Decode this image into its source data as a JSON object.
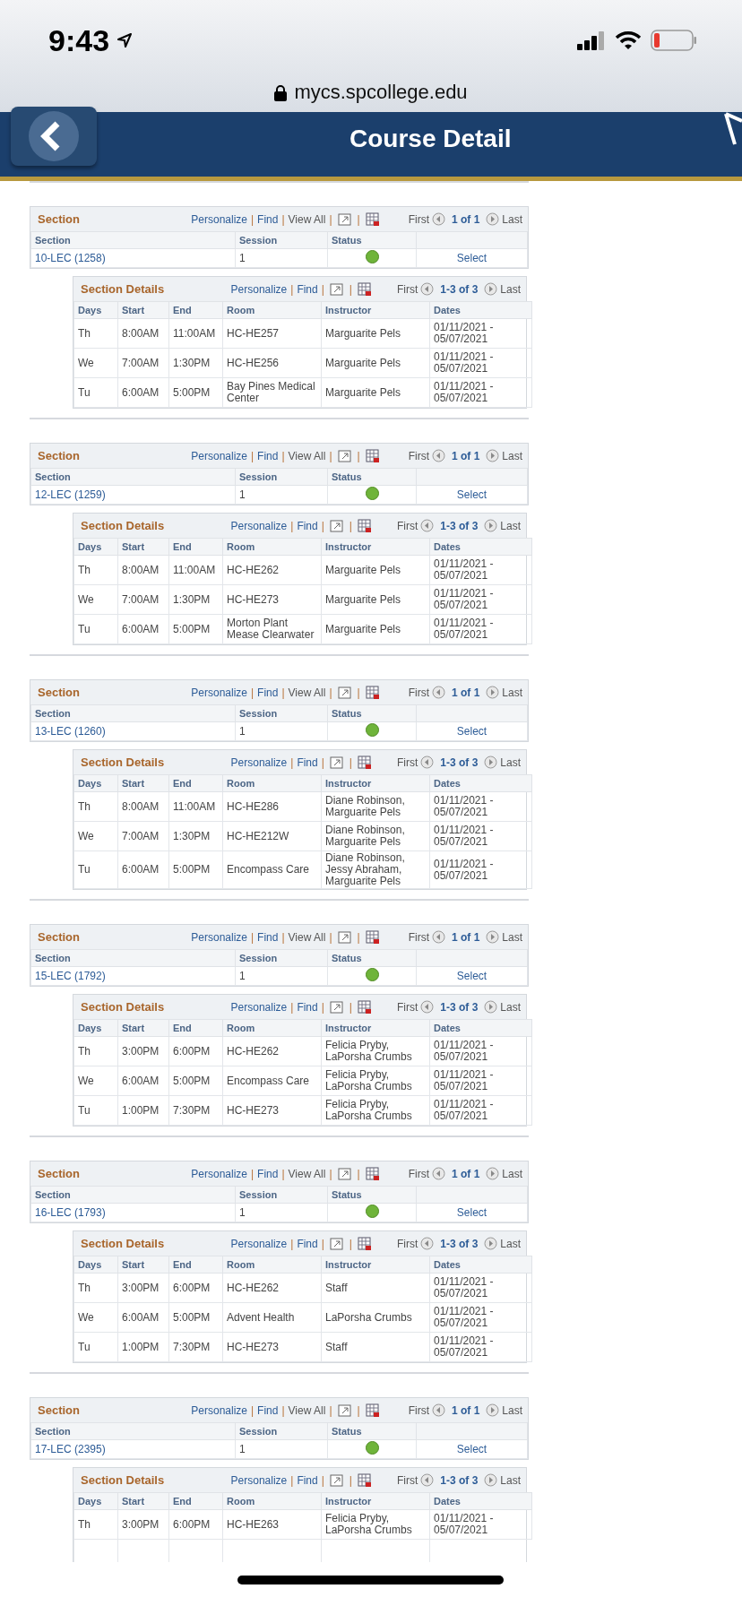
{
  "status_bar": {
    "time": "9:43"
  },
  "url_bar": {
    "url": "mycs.spcollege.edu"
  },
  "header": {
    "title": "Course Detail"
  },
  "sections": [
    {
      "title": "Section",
      "nav": {
        "personalize": "Personalize",
        "find": "Find",
        "view_all": "View All",
        "separators": [
          "|",
          "|",
          "|",
          "|"
        ],
        "first": "First",
        "count": "1 of 1",
        "last": "Last"
      },
      "columns": [
        "Section",
        "Session",
        "Status"
      ],
      "row": {
        "section": "10-LEC (1258)",
        "session": "1",
        "color": "#6fb43a",
        "action": "Select"
      },
      "details": {
        "title": "Section Details",
        "nav": {
          "personalize": "Personalize",
          "find": "Find",
          "separators": [
            "|",
            "|",
            "|"
          ],
          "first": "First",
          "count": "1-3 of 3",
          "last": "Last"
        },
        "columns": [
          "Days",
          "Start",
          "End",
          "Room",
          "Instructor",
          "Dates"
        ],
        "rows": [
          [
            "Th",
            "8:00AM",
            "11:00AM",
            "HC-HE257",
            "Marguarite Pels",
            "01/11/2021 - 05/07/2021"
          ],
          [
            "We",
            "7:00AM",
            "1:30PM",
            "HC-HE256",
            "Marguarite Pels",
            "01/11/2021 - 05/07/2021"
          ],
          [
            "Tu",
            "6:00AM",
            "5:00PM",
            "Bay Pines Medical Center",
            "Marguarite Pels",
            "01/11/2021 - 05/07/2021"
          ]
        ]
      }
    },
    {
      "title": "Section",
      "nav": {
        "personalize": "Personalize",
        "find": "Find",
        "view_all": "View All",
        "separators": [
          "|",
          "|",
          "|",
          "|"
        ],
        "first": "First",
        "count": "1 of 1",
        "last": "Last"
      },
      "columns": [
        "Section",
        "Session",
        "Status"
      ],
      "row": {
        "section": "12-LEC (1259)",
        "session": "1",
        "color": "#6fb43a",
        "action": "Select"
      },
      "details": {
        "title": "Section Details",
        "nav": {
          "personalize": "Personalize",
          "find": "Find",
          "separators": [
            "|",
            "|",
            "|"
          ],
          "first": "First",
          "count": "1-3 of 3",
          "last": "Last"
        },
        "columns": [
          "Days",
          "Start",
          "End",
          "Room",
          "Instructor",
          "Dates"
        ],
        "rows": [
          [
            "Th",
            "8:00AM",
            "11:00AM",
            "HC-HE262",
            "Marguarite Pels",
            "01/11/2021 - 05/07/2021"
          ],
          [
            "We",
            "7:00AM",
            "1:30PM",
            "HC-HE273",
            "Marguarite Pels",
            "01/11/2021 - 05/07/2021"
          ],
          [
            "Tu",
            "6:00AM",
            "5:00PM",
            "Morton Plant Mease Clearwater",
            "Marguarite Pels",
            "01/11/2021 - 05/07/2021"
          ]
        ]
      }
    },
    {
      "title": "Section",
      "nav": {
        "personalize": "Personalize",
        "find": "Find",
        "view_all": "View All",
        "separators": [
          "|",
          "|",
          "|",
          "|"
        ],
        "first": "First",
        "count": "1 of 1",
        "last": "Last"
      },
      "columns": [
        "Section",
        "Session",
        "Status"
      ],
      "row": {
        "section": "13-LEC (1260)",
        "session": "1",
        "color": "#6fb43a",
        "action": "Select"
      },
      "details": {
        "title": "Section Details",
        "nav": {
          "personalize": "Personalize",
          "find": "Find",
          "separators": [
            "|",
            "|",
            "|"
          ],
          "first": "First",
          "count": "1-3 of 3",
          "last": "Last"
        },
        "columns": [
          "Days",
          "Start",
          "End",
          "Room",
          "Instructor",
          "Dates"
        ],
        "rows": [
          [
            "Th",
            "8:00AM",
            "11:00AM",
            "HC-HE286",
            "Diane Robinson, Marguarite Pels",
            "01/11/2021 - 05/07/2021"
          ],
          [
            "We",
            "7:00AM",
            "1:30PM",
            "HC-HE212W",
            "Diane Robinson, Marguarite Pels",
            "01/11/2021 - 05/07/2021"
          ],
          [
            "Tu",
            "6:00AM",
            "5:00PM",
            "Encompass Care",
            "Diane Robinson, Jessy Abraham, Marguarite Pels",
            "01/11/2021 - 05/07/2021"
          ]
        ]
      }
    },
    {
      "title": "Section",
      "nav": {
        "personalize": "Personalize",
        "find": "Find",
        "view_all": "View All",
        "separators": [
          "|",
          "|",
          "|",
          "|"
        ],
        "first": "First",
        "count": "1 of 1",
        "last": "Last"
      },
      "columns": [
        "Section",
        "Session",
        "Status"
      ],
      "row": {
        "section": "15-LEC (1792)",
        "session": "1",
        "color": "#6fb43a",
        "action": "Select"
      },
      "details": {
        "title": "Section Details",
        "nav": {
          "personalize": "Personalize",
          "find": "Find",
          "separators": [
            "|",
            "|",
            "|"
          ],
          "first": "First",
          "count": "1-3 of 3",
          "last": "Last"
        },
        "columns": [
          "Days",
          "Start",
          "End",
          "Room",
          "Instructor",
          "Dates"
        ],
        "rows": [
          [
            "Th",
            "3:00PM",
            "6:00PM",
            "HC-HE262",
            "Felicia Pryby, LaPorsha Crumbs",
            "01/11/2021 - 05/07/2021"
          ],
          [
            "We",
            "6:00AM",
            "5:00PM",
            "Encompass Care",
            "Felicia Pryby, LaPorsha Crumbs",
            "01/11/2021 - 05/07/2021"
          ],
          [
            "Tu",
            "1:00PM",
            "7:30PM",
            "HC-HE273",
            "Felicia Pryby, LaPorsha Crumbs",
            "01/11/2021 - 05/07/2021"
          ]
        ]
      }
    },
    {
      "title": "Section",
      "nav": {
        "personalize": "Personalize",
        "find": "Find",
        "view_all": "View All",
        "separators": [
          "|",
          "|",
          "|",
          "|"
        ],
        "first": "First",
        "count": "1 of 1",
        "last": "Last"
      },
      "columns": [
        "Section",
        "Session",
        "Status"
      ],
      "row": {
        "section": "16-LEC (1793)",
        "session": "1",
        "color": "#6fb43a",
        "action": "Select"
      },
      "details": {
        "title": "Section Details",
        "nav": {
          "personalize": "Personalize",
          "find": "Find",
          "separators": [
            "|",
            "|",
            "|"
          ],
          "first": "First",
          "count": "1-3 of 3",
          "last": "Last"
        },
        "columns": [
          "Days",
          "Start",
          "End",
          "Room",
          "Instructor",
          "Dates"
        ],
        "rows": [
          [
            "Th",
            "3:00PM",
            "6:00PM",
            "HC-HE262",
            "Staff",
            "01/11/2021 - 05/07/2021"
          ],
          [
            "We",
            "6:00AM",
            "5:00PM",
            "Advent Health",
            "LaPorsha Crumbs",
            "01/11/2021 - 05/07/2021"
          ],
          [
            "Tu",
            "1:00PM",
            "7:30PM",
            "HC-HE273",
            "Staff",
            "01/11/2021 - 05/07/2021"
          ]
        ]
      }
    },
    {
      "title": "Section",
      "nav": {
        "personalize": "Personalize",
        "find": "Find",
        "view_all": "View All",
        "separators": [
          "|",
          "|",
          "|",
          "|"
        ],
        "first": "First",
        "count": "1 of 1",
        "last": "Last"
      },
      "columns": [
        "Section",
        "Session",
        "Status"
      ],
      "row": {
        "section": "17-LEC (2395)",
        "session": "1",
        "color": "#6fb43a",
        "action": "Select"
      },
      "details": {
        "title": "Section Details",
        "nav": {
          "personalize": "Personalize",
          "find": "Find",
          "separators": [
            "|",
            "|",
            "|"
          ],
          "first": "First",
          "count": "1-3 of 3",
          "last": "Last"
        },
        "columns": [
          "Days",
          "Start",
          "End",
          "Room",
          "Instructor",
          "Dates"
        ],
        "rows": [
          [
            "Th",
            "3:00PM",
            "6:00PM",
            "HC-HE263",
            "Felicia Pryby, LaPorsha Crumbs",
            "01/11/2021 - 05/07/2021"
          ]
        ]
      }
    }
  ]
}
